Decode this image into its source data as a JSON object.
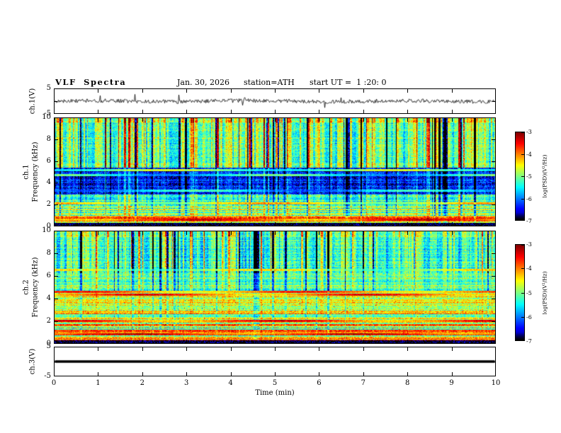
{
  "header": {
    "title": "VLF Spectra",
    "date": "Jan. 30, 2026",
    "station": "station=ATH",
    "start_ut": "start UT =  1 :20: 0"
  },
  "x_axis": {
    "label": "Time (min)",
    "range": [
      0,
      10
    ],
    "ticks": [
      "0",
      "1",
      "2",
      "3",
      "4",
      "5",
      "6",
      "7",
      "8",
      "9",
      "10"
    ]
  },
  "panels": {
    "ch1_wave": {
      "ylabel": "ch.1(V)",
      "ylim": [
        -5,
        5
      ],
      "yticks": [
        "5",
        "-5"
      ]
    },
    "ch1_spec": {
      "ylabel_channel": "ch.1",
      "ylabel_axis": "Frequency (kHz)",
      "ylim": [
        0,
        10
      ],
      "yticks": [
        "10",
        "8",
        "6",
        "4",
        "2",
        "0"
      ]
    },
    "ch2_spec": {
      "ylabel_channel": "ch.2",
      "ylabel_axis": "Frequency (kHz)",
      "ylim": [
        0,
        10
      ],
      "yticks": [
        "10",
        "8",
        "6",
        "4",
        "2",
        "0"
      ]
    },
    "ch3_wave": {
      "ylabel": "ch.3(V)",
      "ylim": [
        -5,
        5
      ],
      "yticks": [
        "5",
        "-5"
      ]
    }
  },
  "colorbars": {
    "label": "log(PSD)(V²/Hz)",
    "range": [
      -7,
      -3
    ],
    "ticks": [
      "-3",
      "-4",
      "-5",
      "-6",
      "-7"
    ]
  },
  "chart_data": [
    {
      "type": "line",
      "name": "ch.1 waveform",
      "xlabel": "Time (min)",
      "xlim": [
        0,
        10
      ],
      "ylabel": "ch.1(V)",
      "ylim": [
        -5,
        5
      ],
      "summary": "Noisy trace centred on 0 V, typical fluctuation about ±1.5 V, sparse impulsive spikes reaching roughly ±3.5 V across the full 10 minutes",
      "baseline": 0,
      "noise_amplitude": 0.8,
      "spike_amplitude": 2.8,
      "spike_rate": 0.025,
      "line_width": 0.8,
      "seed": 17
    },
    {
      "type": "heatmap",
      "name": "ch.1 spectrogram",
      "xlabel": "Time (min)",
      "xlim": [
        0,
        10
      ],
      "ylabel": "ch.1 Frequency (kHz)",
      "ylim": [
        0,
        10
      ],
      "zlabel": "log(PSD)(V²/Hz)",
      "zlim": [
        -7,
        -3
      ],
      "colormap": "jet",
      "summary": "Broadband VLF spectrogram: black gap below 0.25 kHz, intense red/yellow striped band 0.25-1 kHz, green/cyan 1-3 kHz, quiet dark-blue band 2.9-5.4 kHz with faint cyan lines, green speckle with strong vertical interference streaks 5.4-10 kHz, sporadic warm patches at the very top",
      "noise": 0.45,
      "seed": 23,
      "bands": [
        {
          "f": [
            0,
            0.25
          ],
          "level": -7.0,
          "stripe": 0,
          "streak": 0
        },
        {
          "f": [
            0.25,
            0.9
          ],
          "level": -4.35,
          "stripe": 0.95,
          "streak": 0.2
        },
        {
          "f": [
            0.9,
            1.8
          ],
          "level": -4.9,
          "stripe": 0.6,
          "streak": 0.45
        },
        {
          "f": [
            1.8,
            2.9
          ],
          "level": -5.35,
          "stripe": 0.45,
          "streak": 0.55
        },
        {
          "f": [
            2.9,
            5.4
          ],
          "level": -6.35,
          "stripe": 0.3,
          "streak": 0.45
        },
        {
          "f": [
            5.4,
            10
          ],
          "level": -5.05,
          "stripe": 0.22,
          "streak": 1.15
        }
      ],
      "lines": [
        {
          "f": 0.55,
          "level": -3.8
        },
        {
          "f": 2.05,
          "level": -4.6
        },
        {
          "f": 3.25,
          "level": -5.7
        },
        {
          "f": 4.7,
          "level": -5.5
        },
        {
          "f": 5.15,
          "level": -5.1
        }
      ]
    },
    {
      "type": "heatmap",
      "name": "ch.2 spectrogram",
      "xlabel": "Time (min)",
      "xlim": [
        0,
        10
      ],
      "ylabel": "ch.2 Frequency (kHz)",
      "ylim": [
        0,
        10
      ],
      "zlabel": "log(PSD)(V²/Hz)",
      "zlim": [
        -7,
        -3
      ],
      "colormap": "jet",
      "summary": "Broadband VLF spectrogram: black gap below 0.22 kHz, strong yellow/red horizontal striping 0.2-2.7 kHz, yellow-green band to 4.7 kHz with bright yellow lines near 4.3-4.6 kHz, green 4.7-6.3 kHz, cyan/green speckle with vertical interference streaks above 6.3 kHz",
      "noise": 0.45,
      "seed": 31,
      "bands": [
        {
          "f": [
            0,
            0.22
          ],
          "level": -7.0,
          "stripe": 0,
          "streak": 0
        },
        {
          "f": [
            0.22,
            1.1
          ],
          "level": -4.25,
          "stripe": 0.95,
          "streak": 0.15
        },
        {
          "f": [
            1.1,
            2.7
          ],
          "level": -4.5,
          "stripe": 0.85,
          "streak": 0.25
        },
        {
          "f": [
            2.7,
            4.7
          ],
          "level": -4.7,
          "stripe": 0.55,
          "streak": 0.3
        },
        {
          "f": [
            4.7,
            6.3
          ],
          "level": -5.15,
          "stripe": 0.4,
          "streak": 0.55
        },
        {
          "f": [
            6.3,
            10
          ],
          "level": -5.3,
          "stripe": 0.28,
          "streak": 1.05
        }
      ],
      "lines": [
        {
          "f": 0.8,
          "level": -3.7
        },
        {
          "f": 2.0,
          "level": -3.85
        },
        {
          "f": 4.35,
          "level": -3.9
        },
        {
          "f": 4.6,
          "level": -4.05
        },
        {
          "f": 6.55,
          "level": -4.8
        }
      ]
    },
    {
      "type": "line",
      "name": "ch.3 waveform",
      "xlabel": "Time (min)",
      "xlim": [
        0,
        10
      ],
      "ylabel": "ch.3(V)",
      "ylim": [
        -5,
        5
      ],
      "summary": "Perfectly flat thick trace at 0 V for the whole 10 minutes",
      "baseline": 0,
      "noise_amplitude": 0,
      "spike_amplitude": 0,
      "spike_rate": 0,
      "line_width": 3.5,
      "seed": 7
    }
  ]
}
